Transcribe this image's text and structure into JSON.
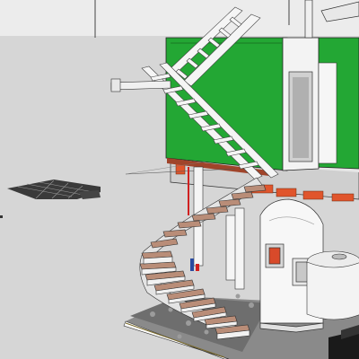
{
  "viewport": {
    "description_hidden": true
  },
  "scene": {
    "sky_color": "#e9e9e9",
    "ground_color": "#d4d4d4",
    "wall_green": "#22a532",
    "wall_green_dark": "#1b8a2a",
    "wall_white": "#f2f2f2",
    "slab_grey": "#c9c9c9",
    "beam_orange": "#e0552c",
    "stair_tread": "#b98d78",
    "stair_riser": "#eeeeee",
    "ladder_white": "#f4f4f4",
    "floor_stone": "#7a7a7a",
    "dark_box": "#1a1a1a"
  }
}
